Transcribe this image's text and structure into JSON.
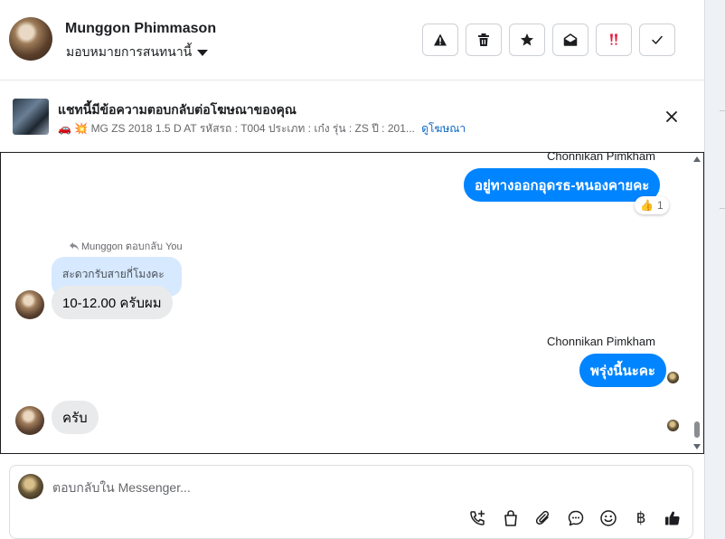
{
  "header": {
    "contact_name": "Munggon Phimmason",
    "assign_label": "มอบหมายการสนทนานี้",
    "actions": [
      {
        "name": "report-spam-button",
        "icon": "warning-icon"
      },
      {
        "name": "delete-button",
        "icon": "trash-icon"
      },
      {
        "name": "star-button",
        "icon": "star-icon"
      },
      {
        "name": "mark-unread-button",
        "icon": "envelope-open-icon"
      },
      {
        "name": "follow-up-button",
        "icon": "double-exclamation-icon"
      },
      {
        "name": "mark-done-button",
        "icon": "check-icon"
      }
    ]
  },
  "ad_banner": {
    "title": "แชทนี้มีข้อความตอบกลับต่อโฆษณาของคุณ",
    "emoji": "🚗 💥",
    "details": "MG ZS 2018 1.5 D AT รหัสรถ : T004 ประเภท : เก๋ง รุ่น : ZS ปี : 201...",
    "link_label": "ดูโฆษณา"
  },
  "messages": {
    "sender_top": "Chonnikan Pimkham",
    "out_1": "อยู่ทางออกอุดรธ-หนองคายคะ",
    "reaction_emoji": "👍",
    "reaction_count": "1",
    "reply_hint": "Munggon ตอบกลับ You",
    "quoted_text": "สะดวกรับสายกี่โมงคะ",
    "in_1": "10-12.00 ครับผม",
    "sender_out_2": "Chonnikan Pimkham",
    "out_2": "พรุ่งนี้นะคะ",
    "in_2": "ครับ"
  },
  "composer": {
    "placeholder": "ตอบกลับใน Messenger...",
    "tools": [
      "call-add-icon",
      "shopping-bag-icon",
      "paperclip-icon",
      "chat-bubble-icon",
      "emoji-icon",
      "baht-icon",
      "thumbs-up-icon"
    ],
    "baht_symbol": "฿"
  },
  "colors": {
    "outgoing_bubble": "#0084ff",
    "incoming_bubble": "#e9eaec",
    "quote_bubble": "#d6e9ff",
    "link": "#0a66c2"
  }
}
